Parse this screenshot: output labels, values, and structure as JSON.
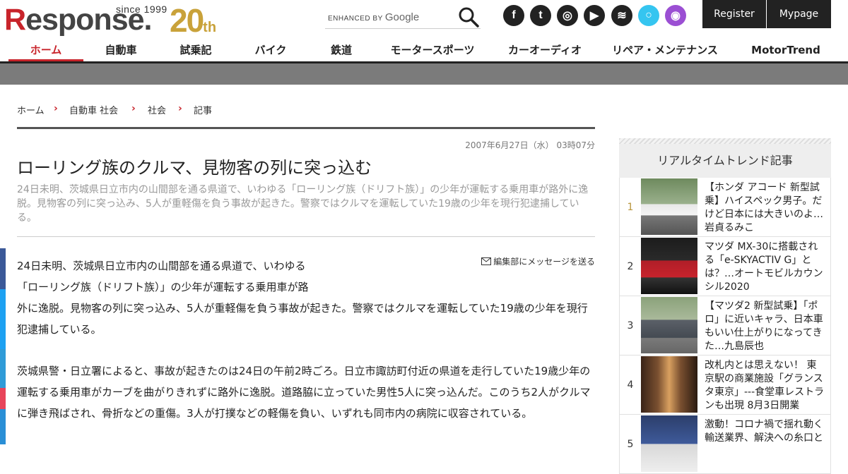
{
  "header": {
    "logo_since": "since 1999",
    "logo_word": "esponse.",
    "logo_r": "R",
    "logo_anniv": "20",
    "logo_anniv_suffix": "th",
    "search_enhanced": "ENHANCED BY",
    "search_google": "Google",
    "register_label": "Register",
    "mypage_label": "Mypage",
    "social": [
      {
        "icon": "facebook-icon",
        "glyph": "f",
        "color": "#222"
      },
      {
        "icon": "twitter-icon",
        "glyph": "t",
        "color": "#222"
      },
      {
        "icon": "instagram-icon",
        "glyph": "◎",
        "color": "#222"
      },
      {
        "icon": "youtube-icon",
        "glyph": "▶",
        "color": "#222"
      },
      {
        "icon": "rss-icon",
        "glyph": "≋",
        "color": "#222"
      },
      {
        "icon": "alexa-icon",
        "glyph": "○",
        "color": "#35c5f0"
      },
      {
        "icon": "podcast-icon",
        "glyph": "◉",
        "color": "#9b4fd3"
      }
    ]
  },
  "nav": {
    "items": [
      "ホーム",
      "自動車",
      "試乗記",
      "バイク",
      "鉄道",
      "モータースポーツ",
      "カーオーディオ",
      "リペア・メンテナンス",
      "MotorTrend"
    ]
  },
  "breadcrumb": [
    "ホーム",
    "自動車 社会",
    "社会",
    "記事"
  ],
  "article": {
    "date": "2007年6月27日（水） 03時07分",
    "title": "ローリング族のクルマ、見物客の列に突っ込む",
    "lead": "24日未明、茨城県日立市内の山間部を通る県道で、いわゆる「ローリング族（ドリフト族）」の少年が運転する乗用車が路外に逸脱。見物客の列に突っ込み、5人が重軽傷を負う事故が起きた。警察ではクルマを運転していた19歳の少年を現行犯逮捕している。",
    "message_link": "編集部にメッセージを送る",
    "para1_line1": "24日未明、茨城県日立市内の山間部を通る県道で、いわゆる",
    "para1_line2": "「ローリング族（ドリフト族）」の少年が運転する乗用車が路",
    "para1_rest": "外に逸脱。見物客の列に突っ込み、5人が重軽傷を負う事故が起きた。警察ではクルマを運転していた19歳の少年を現行犯逮捕している。",
    "para2": "茨城県警・日立署によると、事故が起きたのは24日の午前2時ごろ。日立市諏訪町付近の県道を走行していた19歳少年の運転する乗用車がカーブを曲がりきれずに路外に逸脱。道路脇に立っていた男性5人に突っ込んだ。このうち2人がクルマに弾き飛ばされ、骨折などの重傷。3人が打撲などの軽傷を負い、いずれも同市内の病院に収容されている。"
  },
  "sidebar": {
    "title": "リアルタイムトレンド記事",
    "items": [
      {
        "rank": "1",
        "title": "【ホンダ アコード 新型試乗】ハイスペック男子。だけど日本には大きいのよ…岩貞るみこ",
        "thumb": "white-sedan"
      },
      {
        "rank": "2",
        "title": "マツダ MX-30に搭載される「e-SKYACTIV G」とは？…オートモビルカウンシル2020",
        "thumb": "red-suv"
      },
      {
        "rank": "3",
        "title": "【マツダ2 新型試乗】「ポロ」に近いキャラ、日本車もいい仕上がりになってきた…九島辰也",
        "thumb": "grey-hatchback"
      },
      {
        "rank": "4",
        "title": "改札内とは思えない！ 東京駅の商業施設「グランスタ東京」---食堂車レストランも出現 8月3日開業",
        "thumb": "station-shop"
      },
      {
        "rank": "5",
        "title": "激動！コロナ禍で揺れ動く輸送業界、解決への糸口と",
        "thumb": "people"
      }
    ]
  }
}
